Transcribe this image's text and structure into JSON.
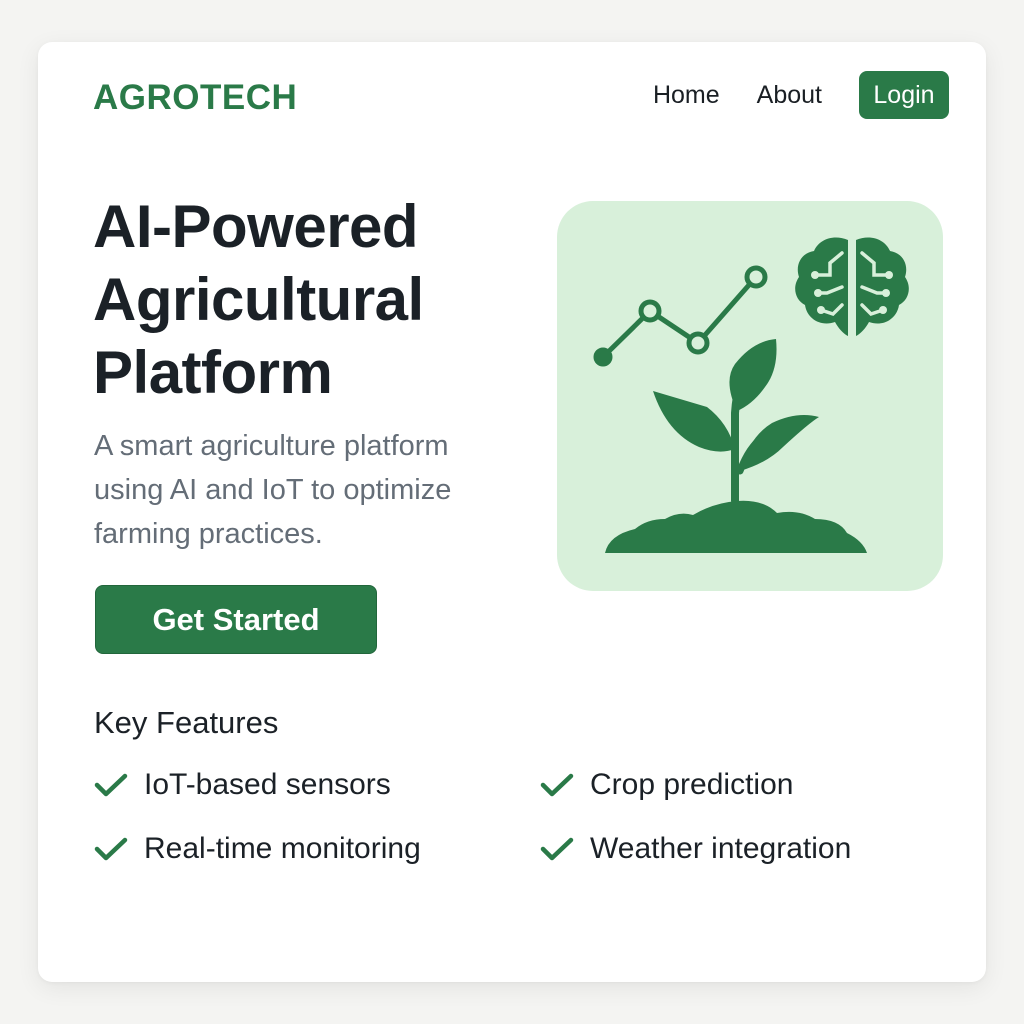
{
  "brand": "AGROTECH",
  "nav": {
    "home": "Home",
    "about": "About",
    "login": "Login"
  },
  "hero": {
    "title": "AI-Powered Agricultural Platform",
    "subtitle": "A smart agriculture platform using AI and IoT to optimize farming practices.",
    "cta": "Get Started",
    "illustration_icons": [
      "trend-line-chart-icon",
      "brain-circuit-icon",
      "seedling-plant-icon",
      "soil-mound-icon"
    ]
  },
  "features": {
    "title": "Key Features",
    "items": [
      "IoT-based sensors",
      "Crop prediction",
      "Real-time monitoring",
      "Weather integration"
    ],
    "item_icon": "checkmark-icon"
  },
  "colors": {
    "accent": "#2a7a48",
    "illustration_bg": "#d8f0da",
    "heading": "#1b2127",
    "body_text": "#646d77",
    "page_bg": "#f4f4f2"
  }
}
